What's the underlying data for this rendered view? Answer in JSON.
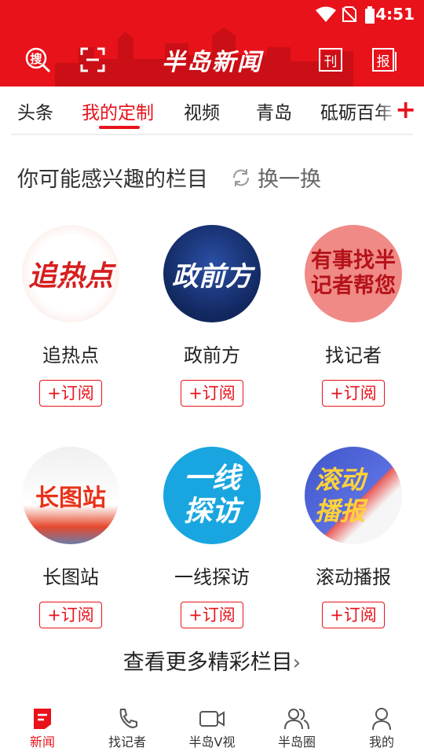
{
  "status_bar": {
    "time": "4:51"
  },
  "header": {
    "logo": "半岛新闻",
    "left_icons": [
      "search-icon",
      "scan-icon"
    ],
    "right_icons": [
      "periodical-icon",
      "newspaper-icon"
    ],
    "colors": {
      "brand_red": "#e8121a"
    }
  },
  "tabs": {
    "items": [
      {
        "label": "头条"
      },
      {
        "label": "我的定制"
      },
      {
        "label": "视频"
      },
      {
        "label": "青岛"
      },
      {
        "label": "砥砺百年"
      }
    ],
    "active_index": 1,
    "add_symbol": "+"
  },
  "section": {
    "title": "你可能感兴趣的栏目",
    "refresh_label": "换一换"
  },
  "columns": [
    {
      "name": "追热点",
      "thumb_text": "追热点",
      "subscribe_label": "+订阅"
    },
    {
      "name": "政前方",
      "thumb_text": "政前方",
      "subscribe_label": "+订阅"
    },
    {
      "name": "找记者",
      "thumb_text": "有事找半记者帮您",
      "subscribe_label": "+订阅"
    },
    {
      "name": "长图站",
      "thumb_text": "长图站",
      "subscribe_label": "+订阅"
    },
    {
      "name": "一线探访",
      "thumb_text": "一线探访",
      "subscribe_label": "+订阅"
    },
    {
      "name": "滚动播报",
      "thumb_text": "滚动播报",
      "subscribe_label": "+订阅"
    }
  ],
  "more": {
    "label": "查看更多精彩栏目",
    "chevron": "›"
  },
  "bottom_nav": [
    {
      "label": "新闻",
      "icon": "news-icon",
      "active": true
    },
    {
      "label": "找记者",
      "icon": "phone-icon",
      "active": false
    },
    {
      "label": "半岛V视",
      "icon": "video-icon",
      "active": false
    },
    {
      "label": "半岛圈",
      "icon": "community-icon",
      "active": false
    },
    {
      "label": "我的",
      "icon": "profile-icon",
      "active": false
    }
  ]
}
